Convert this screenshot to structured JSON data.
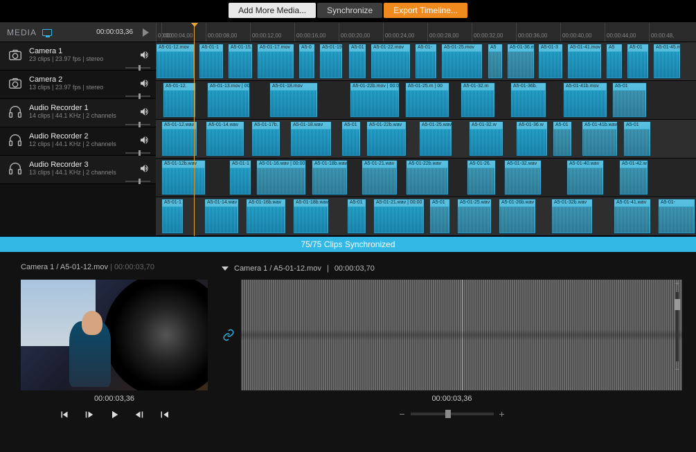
{
  "topbar": {
    "add_media": "Add More Media...",
    "sync": "Synchronize",
    "export": "Export Timeline..."
  },
  "media_header": {
    "label": "MEDIA",
    "timecode": "00:00:03,36"
  },
  "ruler_ticks": [
    "00:00",
    "00:00:04,00",
    "00:00:08,00",
    "00:00:12,00",
    "00:00:16,00",
    "00:00:20,00",
    "00:00:24,00",
    "00:00:28,00",
    "00:00:32,00",
    "00:00:36,00",
    "00:00:40,00",
    "00:00:44,00",
    "00:00:48,"
  ],
  "tracks": [
    {
      "name": "Camera 1",
      "meta": "23 clips  |  23.97 fps  |  stereo",
      "type": "camera",
      "clips": [
        {
          "w": 56,
          "label": "A5-01-12.mov"
        },
        {
          "g": 2
        },
        {
          "w": 36,
          "label": "A5-01-1"
        },
        {
          "g": 2
        },
        {
          "w": 36,
          "label": "A5-01-15."
        },
        {
          "g": 2
        },
        {
          "w": 54,
          "label": "A5-01-17.mov"
        },
        {
          "g": 2
        },
        {
          "w": 24,
          "label": "A5-0"
        },
        {
          "g": 2
        },
        {
          "w": 34,
          "label": "A5-01-19"
        },
        {
          "g": 4
        },
        {
          "w": 26,
          "label": "A5-01"
        },
        {
          "g": 2
        },
        {
          "w": 58,
          "label": "A5-01-22.mov"
        },
        {
          "g": 2
        },
        {
          "w": 32,
          "label": "A5-01-"
        },
        {
          "g": 2
        },
        {
          "w": 60,
          "label": "A5-01-25.mov"
        },
        {
          "g": 3
        },
        {
          "w": 22,
          "label": "A5"
        },
        {
          "g": 2
        },
        {
          "w": 40,
          "label": "A5-01-36.m"
        },
        {
          "g": 1
        },
        {
          "w": 36,
          "label": "A5-01-3"
        },
        {
          "g": 2
        },
        {
          "w": 50,
          "label": "A5-01-41.mov"
        },
        {
          "g": 2
        },
        {
          "w": 24,
          "label": "A5"
        },
        {
          "g": 2
        },
        {
          "w": 32,
          "label": "A5-01"
        },
        {
          "g": 2
        },
        {
          "w": 40,
          "label": "A5-01-45.m"
        }
      ]
    },
    {
      "name": "Camera 2",
      "meta": "13 clips  |  23.97 fps  |  stereo",
      "type": "camera",
      "clips": [
        {
          "g": 8
        },
        {
          "w": 48,
          "label": "A5-01-12."
        },
        {
          "g": 12
        },
        {
          "w": 62,
          "label": "A5-01-13.mov | 00:00"
        },
        {
          "g": 24
        },
        {
          "w": 70,
          "label": "A5-01-18.mov"
        },
        {
          "g": 42
        },
        {
          "w": 72,
          "label": "A5-01-22b.mov | 00:00"
        },
        {
          "g": 4
        },
        {
          "w": 64,
          "label": "A5-01-25.m | 00"
        },
        {
          "g": 12
        },
        {
          "w": 50,
          "label": "A5-01-32.m"
        },
        {
          "g": 18
        },
        {
          "w": 52,
          "label": "A5-01-36b."
        },
        {
          "g": 20
        },
        {
          "w": 64,
          "label": "A5-01-41b.mov"
        },
        {
          "g": 3
        },
        {
          "w": 50,
          "label": "A5-01"
        }
      ]
    },
    {
      "name": "Audio Recorder 1",
      "meta": "14 clips  |  44.1 KHz  |  2 channels",
      "type": "audio",
      "clips": [
        {
          "g": 6
        },
        {
          "w": 52,
          "label": "A5-01-12.wav"
        },
        {
          "g": 8
        },
        {
          "w": 56,
          "label": "A5-01-14.wav"
        },
        {
          "g": 6
        },
        {
          "w": 42,
          "label": "A5-01-17b."
        },
        {
          "g": 10
        },
        {
          "w": 60,
          "label": "A5-01-18.wav"
        },
        {
          "g": 10
        },
        {
          "w": 28,
          "label": "A5-01"
        },
        {
          "g": 4
        },
        {
          "w": 58,
          "label": "A5-01-22b.wav"
        },
        {
          "g": 14
        },
        {
          "w": 48,
          "label": "A5-01-25.wav"
        },
        {
          "g": 20
        },
        {
          "w": 50,
          "label": "A5-01-32.w"
        },
        {
          "g": 14
        },
        {
          "w": 46,
          "label": "A5-01-36.w"
        },
        {
          "g": 3
        },
        {
          "w": 28,
          "label": "A5-01"
        },
        {
          "g": 10
        },
        {
          "w": 52,
          "label": "A5-01-41b.wav"
        },
        {
          "g": 4
        },
        {
          "w": 40,
          "label": "A5-01"
        }
      ]
    },
    {
      "name": "Audio Recorder 2",
      "meta": "12 clips  |  44.1 KHz  |  2 channels",
      "type": "audio",
      "clips": [
        {
          "g": 6
        },
        {
          "w": 64,
          "label": "A5-01-12b.wav"
        },
        {
          "g": 30
        },
        {
          "w": 32,
          "label": "A5-01-1"
        },
        {
          "g": 3
        },
        {
          "w": 72,
          "label": "A5-01-16.wav | 00:00"
        },
        {
          "g": 4
        },
        {
          "w": 52,
          "label": "A5-01-18b.wav"
        },
        {
          "g": 16
        },
        {
          "w": 52,
          "label": "A5-01-21.wav"
        },
        {
          "g": 8
        },
        {
          "w": 62,
          "label": "A5-01-22b.wav"
        },
        {
          "g": 22
        },
        {
          "w": 42,
          "label": "A5-01-26."
        },
        {
          "g": 8
        },
        {
          "w": 54,
          "label": "A5-01-32.wav"
        },
        {
          "g": 32
        },
        {
          "w": 54,
          "label": "A5-01-40.wav"
        },
        {
          "g": 18
        },
        {
          "w": 42,
          "label": "A5-01-42.w"
        }
      ]
    },
    {
      "name": "Audio Recorder 3",
      "meta": "13 clips  |  44.1 KHz  |  2 channels",
      "type": "audio",
      "clips": [
        {
          "g": 6
        },
        {
          "w": 32,
          "label": "A5-01-1"
        },
        {
          "g": 26
        },
        {
          "w": 50,
          "label": "A5-01-14.wav"
        },
        {
          "g": 6
        },
        {
          "w": 58,
          "label": "A5-01-16b.wav"
        },
        {
          "g": 6
        },
        {
          "w": 52,
          "label": "A5-01-18b.wav"
        },
        {
          "g": 22
        },
        {
          "w": 28,
          "label": "A5-01"
        },
        {
          "g": 6
        },
        {
          "w": 74,
          "label": "A5-01-21.wav   | 00:00"
        },
        {
          "g": 3
        },
        {
          "w": 30,
          "label": "A5-01"
        },
        {
          "g": 6
        },
        {
          "w": 50,
          "label": "A5-01-25.wav"
        },
        {
          "g": 6
        },
        {
          "w": 54,
          "label": "A5-01-26b.wav"
        },
        {
          "g": 18
        },
        {
          "w": 60,
          "label": "A5-01-32b.wav"
        },
        {
          "g": 26
        },
        {
          "w": 54,
          "label": "A5-01-41.wav"
        },
        {
          "g": 6
        },
        {
          "w": 54,
          "label": "A5-01-"
        }
      ]
    }
  ],
  "sync_banner": "75/75  Clips Synchronized",
  "preview": {
    "source": "Camera 1 / A5-01-12.mov",
    "source_tc": "00:00:03,70",
    "tc": "00:00:03,36"
  },
  "waveform": {
    "source": "Camera 1 / A5-01-12.mov",
    "source_tc": "00:00:03,70",
    "tc": "00:00:03,36"
  }
}
